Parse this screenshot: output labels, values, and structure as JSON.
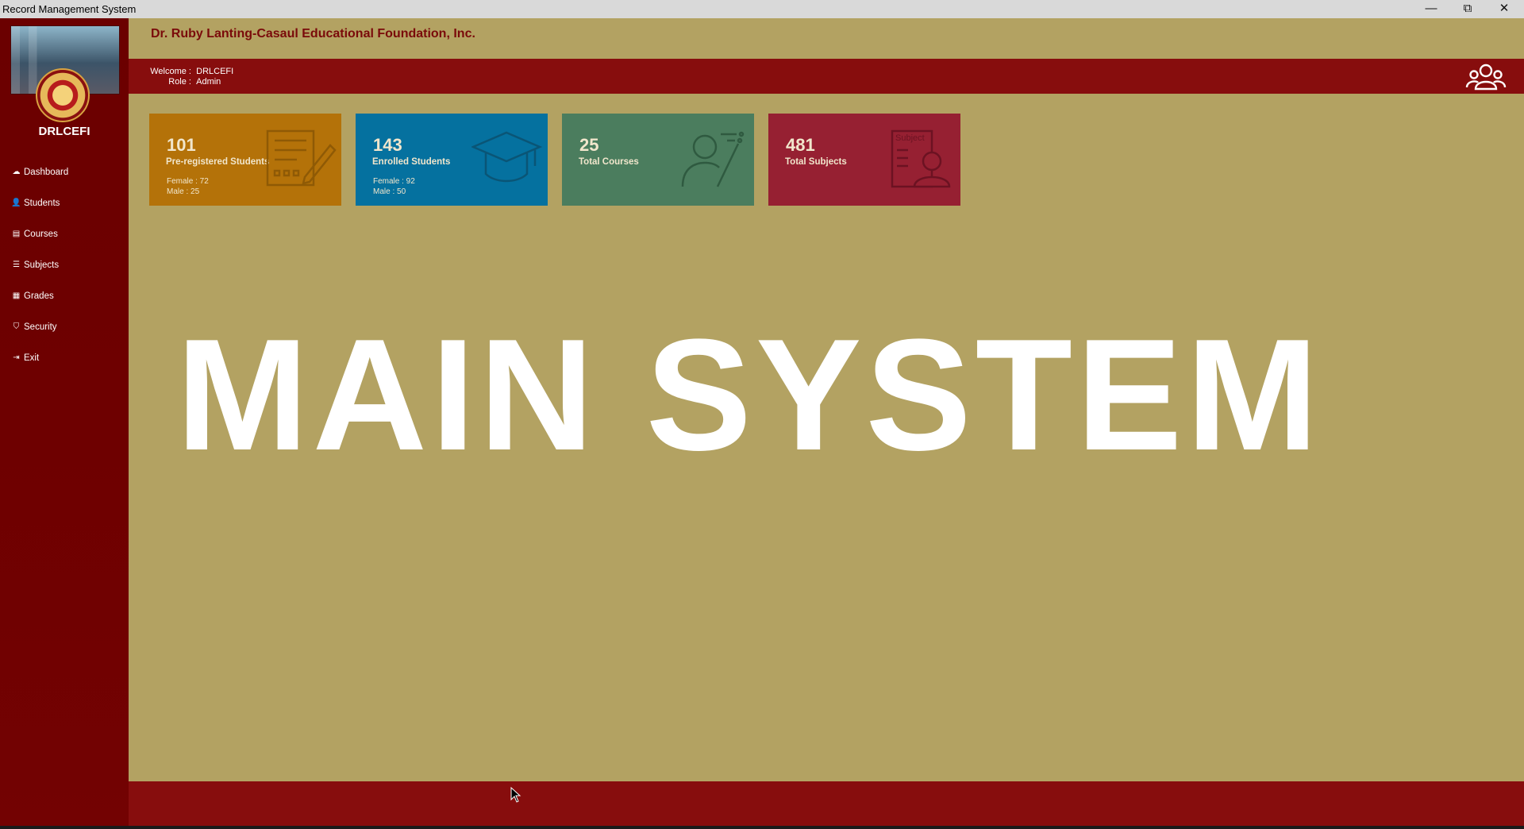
{
  "window": {
    "title": "Record Management System",
    "minimize_icon": "minimize-icon",
    "restore_icon": "restore-icon",
    "close_icon": "close-icon"
  },
  "sidebar": {
    "org_code": "DRLCEFI",
    "items": [
      {
        "label": "Dashboard",
        "icon": "dashboard-icon",
        "glyph": "☁"
      },
      {
        "label": "Students",
        "icon": "student-icon",
        "glyph": "👤"
      },
      {
        "label": "Courses",
        "icon": "courses-icon",
        "glyph": "▤"
      },
      {
        "label": "Subjects",
        "icon": "subjects-icon",
        "glyph": "☰"
      },
      {
        "label": "Grades",
        "icon": "grades-icon",
        "glyph": "▦"
      },
      {
        "label": "Security",
        "icon": "shield-icon",
        "glyph": "⛉"
      },
      {
        "label": "Exit",
        "icon": "exit-icon",
        "glyph": "⇥"
      }
    ]
  },
  "header": {
    "foundation_name": "Dr. Ruby Lanting-Casaul Educational Foundation, Inc.",
    "welcome_label": "Welcome :",
    "welcome_value": "DRLCEFI",
    "role_label": "Role :",
    "role_value": "Admin"
  },
  "cards": [
    {
      "number": "101",
      "label": "Pre-registered Students",
      "female": "Female : 72",
      "male": "Male : 25",
      "icon": "form-icon",
      "color": "#b47209"
    },
    {
      "number": "143",
      "label": "Enrolled Students",
      "female": "Female : 92",
      "male": "Male : 50",
      "icon": "graduation-cap-icon",
      "color": "#05719f"
    },
    {
      "number": "25",
      "label": "Total Courses",
      "female": "",
      "male": "",
      "icon": "teacher-icon",
      "color": "#4b7d5e"
    },
    {
      "number": "481",
      "label": "Total Subjects",
      "female": "",
      "male": "",
      "icon": "subject-icon",
      "color": "#962032"
    }
  ],
  "subject_icon_text": "Subject",
  "main_banner": "MAIN SYSTEM",
  "colors": {
    "background": "#b3a262",
    "sidebar": "#6e0000",
    "accent_bar": "#870d0d"
  }
}
